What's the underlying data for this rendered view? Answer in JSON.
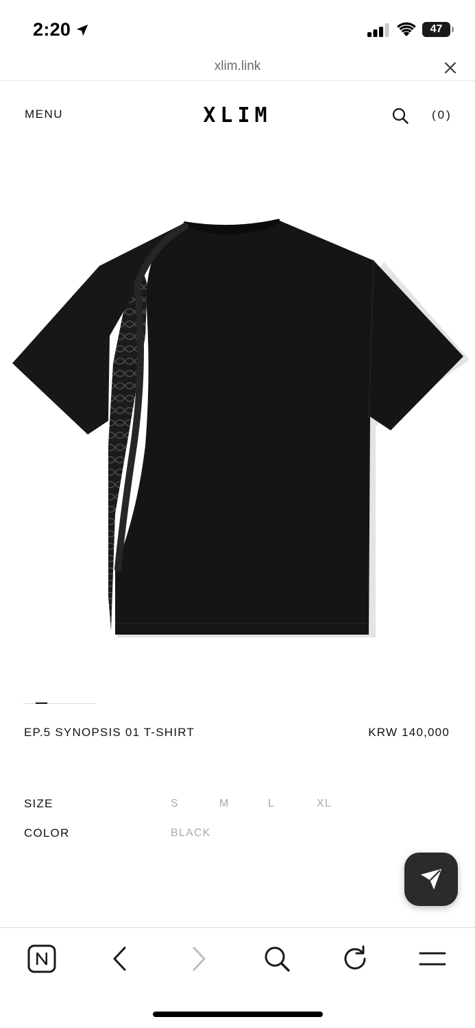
{
  "status_bar": {
    "time": "2:20",
    "battery_percent": "47",
    "battery_level": 0.47,
    "signal_bars": 3,
    "icons": [
      "location-arrow-icon",
      "signal-icon",
      "wifi-icon",
      "battery-icon"
    ]
  },
  "browser": {
    "url": "xlim.link",
    "close_icon": "close-icon"
  },
  "site_header": {
    "menu_label": "MENU",
    "logo": "XLIM",
    "search_icon": "search-icon",
    "cart_label": "(0)"
  },
  "product": {
    "image_icon": "t-shirt-image",
    "image_count": 6,
    "image_index": 2,
    "name": "EP.5 SYNOPSIS 01 T-SHIRT",
    "price": "KRW 140,000",
    "size_label": "SIZE",
    "sizes": [
      "S",
      "M",
      "L",
      "XL"
    ],
    "color_label": "COLOR",
    "colors": [
      "BLACK"
    ]
  },
  "share_button": {
    "icon": "send-icon"
  },
  "toolbar": {
    "icons": [
      "naver-home-icon",
      "back-arrow-icon",
      "forward-arrow-icon",
      "search-icon",
      "reload-icon",
      "menu-icon"
    ],
    "forward_enabled": false
  },
  "colors": {
    "text": "#111111",
    "muted": "#a9a9a9",
    "url_text": "#6b6b6b",
    "fab": "#2b2b2b",
    "shirt": "#151515"
  }
}
